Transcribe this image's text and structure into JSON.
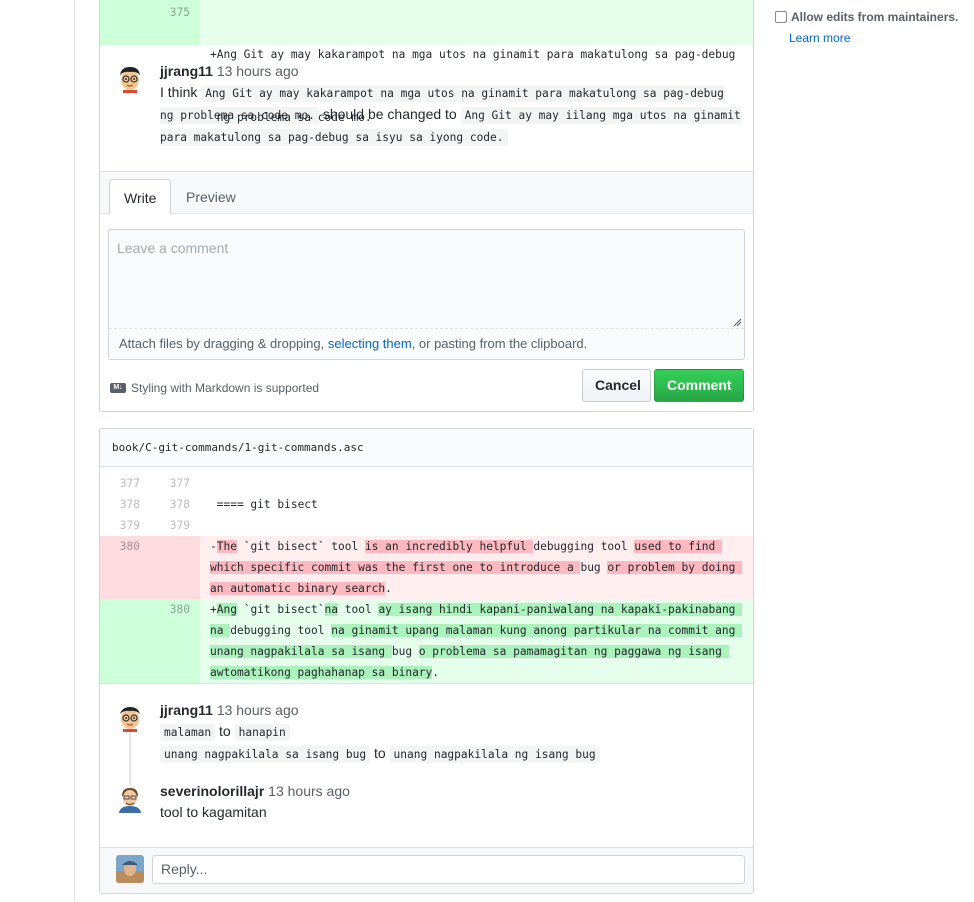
{
  "sidebar": {
    "allow_edits_label": "Allow edits from maintainers.",
    "learn_more": "Learn more"
  },
  "top_diff": {
    "line_no": "375",
    "code_line1": "+Ang Git ay may kakarampot na mga utos na ginamit para makatulong sa pag-debug",
    "code_line2": " ng problema sa code mo."
  },
  "comment1": {
    "author": "jjrang11",
    "time": "13 hours ago",
    "prefix": "I think",
    "code_a": "Ang Git ay may kakarampot na mga utos na ginamit para makatulong sa pag-debug ng problema sa code mo.",
    "middle": "should be changed to",
    "code_b": "Ang Git ay may iilang mga utos na ginamit para makatulong sa pag-debug sa isyu sa iyong code."
  },
  "editor": {
    "tab_write": "Write",
    "tab_preview": "Preview",
    "placeholder": "Leave a comment",
    "attach_prefix": "Attach files by dragging & dropping, ",
    "attach_link": "selecting them",
    "attach_suffix": ", or pasting from the clipboard.",
    "markdown_icon": "M↓",
    "markdown_note": "Styling with Markdown is supported",
    "cancel": "Cancel",
    "comment": "Comment"
  },
  "file2": {
    "path": "book/C-git-commands/1-git-commands.asc",
    "lines": [
      {
        "old": "377",
        "new": "377",
        "code": ""
      },
      {
        "old": "378",
        "new": "378",
        "code": " ==== git bisect"
      },
      {
        "old": "379",
        "new": "379",
        "code": ""
      }
    ],
    "del": {
      "old": "380",
      "segments": [
        {
          "t": "-",
          "h": false
        },
        {
          "t": "The",
          "h": true
        },
        {
          "t": " `git bisect` tool ",
          "h": false
        },
        {
          "t": "is an incredibly helpful ",
          "h": true
        },
        {
          "t": "debugging tool ",
          "h": false
        },
        {
          "t": "used to find which specific commit was the first one to introduce a ",
          "h": true
        },
        {
          "t": "bug ",
          "h": false
        },
        {
          "t": "or problem by doing an automatic binary search",
          "h": true
        },
        {
          "t": ".",
          "h": false
        }
      ]
    },
    "add": {
      "new": "380",
      "segments": [
        {
          "t": "+",
          "h": false
        },
        {
          "t": "Ang",
          "h": true
        },
        {
          "t": " `git bisect`",
          "h": false
        },
        {
          "t": "na",
          "h": true
        },
        {
          "t": " tool ",
          "h": false
        },
        {
          "t": "ay isang hindi kapani-paniwalang na kapaki-pakinabang na ",
          "h": true
        },
        {
          "t": "debugging tool ",
          "h": false
        },
        {
          "t": "na ginamit upang malaman kung anong partikular na commit ang unang nagpakilala sa isang ",
          "h": true
        },
        {
          "t": "bug ",
          "h": false
        },
        {
          "t": "o problema sa pamamagitan ng paggawa ng isang awtomatikong paghahanap sa binary",
          "h": true
        },
        {
          "t": ".",
          "h": false
        }
      ]
    }
  },
  "thread": {
    "c1_author": "jjrang11",
    "c1_time": "13 hours ago",
    "c1_code1": "malaman",
    "c1_to1": "to",
    "c1_code2": "hanapin",
    "c1_code3": "unang nagpakilala sa isang bug",
    "c1_to2": "to",
    "c1_code4": "unang nagpakilala ng isang bug",
    "c2_author": "severinolorillajr",
    "c2_time": "13 hours ago",
    "c2_body": "tool to kagamitan",
    "reply_placeholder": "Reply..."
  }
}
